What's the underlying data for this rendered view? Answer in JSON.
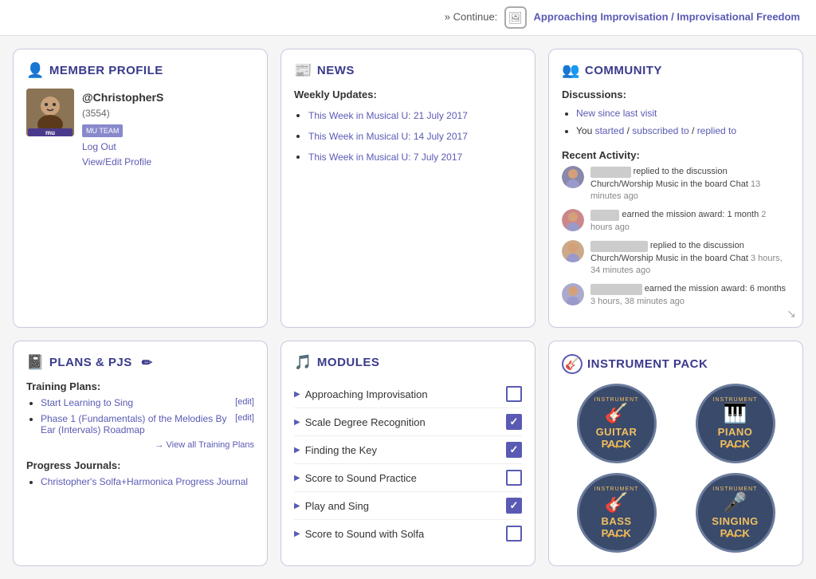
{
  "topbar": {
    "continue_prefix": "» Continue:",
    "continue_icon_char": "🖼",
    "continue_link": "Approaching Improvisation / Improvisational Freedom"
  },
  "member_profile": {
    "title": "MEMBER PROFILE",
    "title_icon": "👤",
    "username": "@ChristopherS",
    "user_id": "(3554)",
    "team_badge": "MU TEAM",
    "mu_label": "mu",
    "log_out": "Log Out",
    "view_edit": "View/Edit Profile"
  },
  "news": {
    "title": "NEWS",
    "title_icon": "📰",
    "weekly_label": "Weekly Updates:",
    "items": [
      {
        "text": "This Week in Musical U: 21 July 2017",
        "href": "#"
      },
      {
        "text": "This Week in Musical U: 14 July 2017",
        "href": "#"
      },
      {
        "text": "This Week in Musical U: 7 July 2017",
        "href": "#"
      }
    ]
  },
  "community": {
    "title": "COMMUNITY",
    "title_icon": "👥",
    "discussions_label": "Discussions:",
    "discussion_items": [
      {
        "text": "New since last visit"
      },
      {
        "parts": [
          "You ",
          "started",
          " / ",
          "subscribed to",
          " / ",
          "replied to"
        ]
      }
    ],
    "recent_label": "Recent Activity:",
    "activities": [
      {
        "blurred_name": "██████",
        "text": "replied to the discussion Church/Worship Music in the board Chat",
        "time": "13 minutes ago",
        "avatar_color": "#8888aa"
      },
      {
        "blurred_name": "████",
        "text": "earned the mission award: 1 month",
        "time": "2 hours ago",
        "avatar_color": "#cc8888"
      },
      {
        "blurred_name": "█████████",
        "text": "replied to the discussion Church/Worship Music in the board Chat",
        "time": "3 hours, 34 minutes ago",
        "avatar_color": "#ccaa88"
      },
      {
        "blurred_name": "████████",
        "text": "earned the mission award: 6 months",
        "time": "3 hours, 38 minutes ago",
        "avatar_color": "#aaaacc"
      }
    ]
  },
  "plans": {
    "title": "PLANS & PJS",
    "title_icon": "📓",
    "edit_icon": "✏",
    "training_label": "Training Plans:",
    "training_items": [
      {
        "label": "Start Learning to Sing",
        "edit": "[edit]"
      },
      {
        "label": "Phase 1 (Fundamentals) of the Melodies By Ear (Intervals) Roadmap",
        "edit": "[edit]"
      }
    ],
    "view_all": "→ View all Training Plans",
    "journals_label": "Progress Journals:",
    "journal_items": [
      {
        "label": "Christopher's Solfa+Harmonica Progress Journal"
      }
    ]
  },
  "modules": {
    "title": "MODULES",
    "title_icon": "🎵",
    "items": [
      {
        "label": "Approaching Improvisation",
        "checked": false
      },
      {
        "label": "Scale Degree Recognition",
        "checked": true
      },
      {
        "label": "Finding the Key",
        "checked": true
      },
      {
        "label": "Score to Sound Practice",
        "checked": false
      },
      {
        "label": "Play and Sing",
        "checked": true
      },
      {
        "label": "Score to Sound with Solfa",
        "checked": false
      }
    ]
  },
  "instrument_pack": {
    "title": "INSTRUMENT PACK",
    "title_icon": "🎸",
    "packs": [
      {
        "icon": "🎸",
        "label": "GUITAR\nPACK",
        "top": "INSTRUMENT",
        "bottom": "✦ ✦ ✦"
      },
      {
        "icon": "🎹",
        "label": "PIANO\nPACK",
        "top": "INSTRUMENT",
        "bottom": "✦ ✦ ✦"
      },
      {
        "icon": "🎸",
        "label": "BASS\nPACK",
        "top": "INSTRUMENT",
        "bottom": "✦ ✦ ✦"
      },
      {
        "icon": "🎤",
        "label": "SINGING\nPACK",
        "top": "INSTRUMENT",
        "bottom": "✦ ✦ ✦"
      }
    ]
  }
}
